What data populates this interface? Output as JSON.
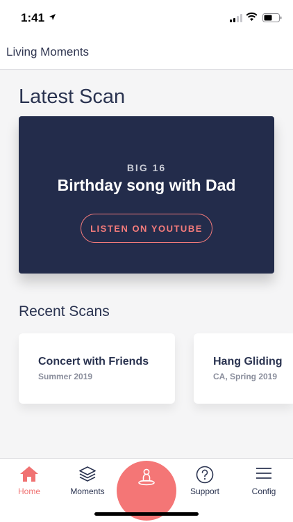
{
  "status_bar": {
    "time": "1:41"
  },
  "header": {
    "title": "Living Moments"
  },
  "latest": {
    "section_title": "Latest Scan",
    "kicker": "BIG 16",
    "title": "Birthday song with Dad",
    "button_label": "LISTEN ON YOUTUBE"
  },
  "recent": {
    "section_title": "Recent Scans",
    "items": [
      {
        "title": "Concert with Friends",
        "subtitle": "Summer 2019"
      },
      {
        "title": "Hang Gliding",
        "subtitle": "CA, Spring 2019"
      }
    ]
  },
  "tabs": [
    {
      "label": "Home",
      "icon": "home-icon",
      "active": true
    },
    {
      "label": "Moments",
      "icon": "layers-icon",
      "active": false
    },
    {
      "label": "",
      "icon": "scan-person-icon",
      "active": false
    },
    {
      "label": "Support",
      "icon": "help-circle-icon",
      "active": false
    },
    {
      "label": "Config",
      "icon": "menu-icon",
      "active": false
    }
  ],
  "colors": {
    "accent": "#f47676",
    "card_dark": "#232c4b",
    "text_primary": "#2a3350",
    "text_secondary": "#8a8e9c"
  }
}
